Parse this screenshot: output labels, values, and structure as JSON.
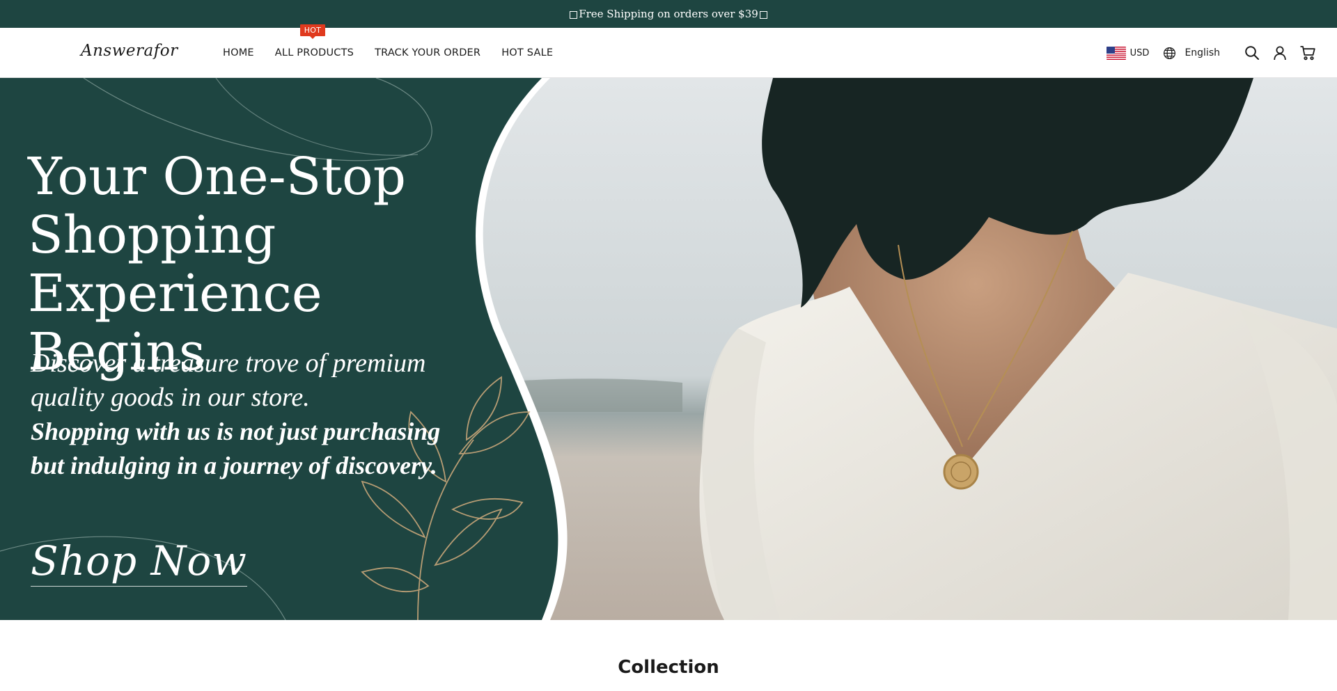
{
  "announcement": {
    "text": "Free Shipping on orders over $39"
  },
  "header": {
    "logo_text": "Answerafor",
    "nav": [
      {
        "label": "HOME"
      },
      {
        "label": "ALL PRODUCTS",
        "badge": "HOT"
      },
      {
        "label": "TRACK YOUR ORDER"
      },
      {
        "label": "HOT SALE"
      }
    ],
    "currency": "USD",
    "language": "English",
    "icons": [
      "globe-icon",
      "search-icon",
      "account-icon",
      "cart-icon"
    ]
  },
  "hero": {
    "title": "Your One-Stop Shopping Experience Begins",
    "subtitle": "Discover a treasure trove of premium quality goods in our store.",
    "subtitle_bold": "Shopping with us is not just purchasing but indulging in a journey of discovery.",
    "cta_label": "Shop Now"
  },
  "section": {
    "title": "Collection"
  },
  "colors": {
    "brand_green": "#1e4541",
    "badge_red": "#e03a1e",
    "gold_accent": "#c9a77a"
  }
}
